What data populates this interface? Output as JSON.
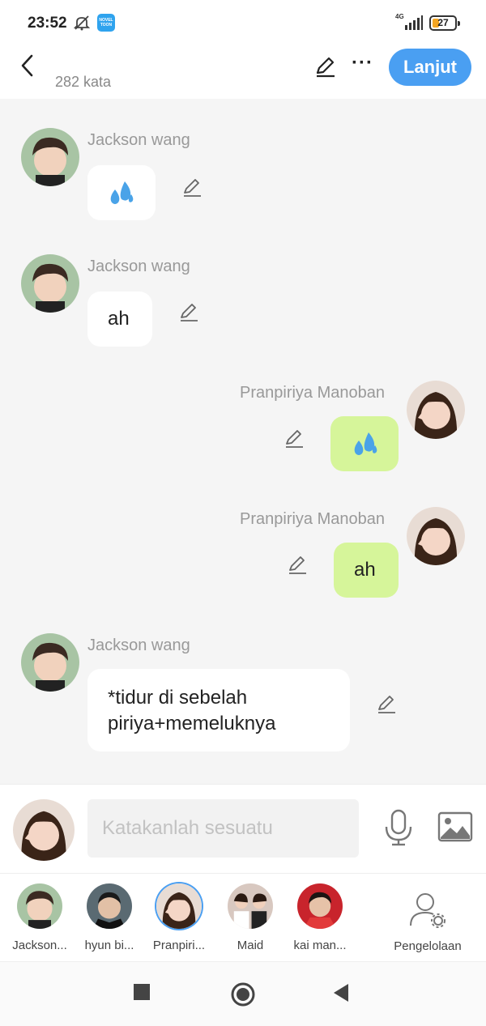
{
  "status_bar": {
    "time": "23:52",
    "app_badge": "NOVEL TOON",
    "network": "4G",
    "battery": "27"
  },
  "header": {
    "word_count": "282 kata",
    "next_label": "Lanjut"
  },
  "colors": {
    "accent": "#4a9ff2",
    "my_bubble": "#d6f59a",
    "chat_bg": "#f5f5f5"
  },
  "messages": [
    {
      "sender": "Jackson wang",
      "side": "left",
      "content": "💦",
      "kind": "emoji"
    },
    {
      "sender": "Jackson wang",
      "side": "left",
      "content": "ah",
      "kind": "text"
    },
    {
      "sender": "Pranpiriya Manoban",
      "side": "right",
      "content": "💦",
      "kind": "emoji"
    },
    {
      "sender": "Pranpiriya Manoban",
      "side": "right",
      "content": "ah",
      "kind": "text"
    },
    {
      "sender": "Jackson wang",
      "side": "left",
      "content_lines": [
        "*tidur di sebelah",
        "piriya+memeluknya"
      ],
      "kind": "text"
    }
  ],
  "composer": {
    "placeholder": "Katakanlah sesuatu"
  },
  "characters": [
    {
      "label": "Jackson..."
    },
    {
      "label": "hyun bi..."
    },
    {
      "label": "Pranpiri..."
    },
    {
      "label": "Maid"
    },
    {
      "label": "kai man..."
    }
  ],
  "manage_label": "Pengelolaan"
}
